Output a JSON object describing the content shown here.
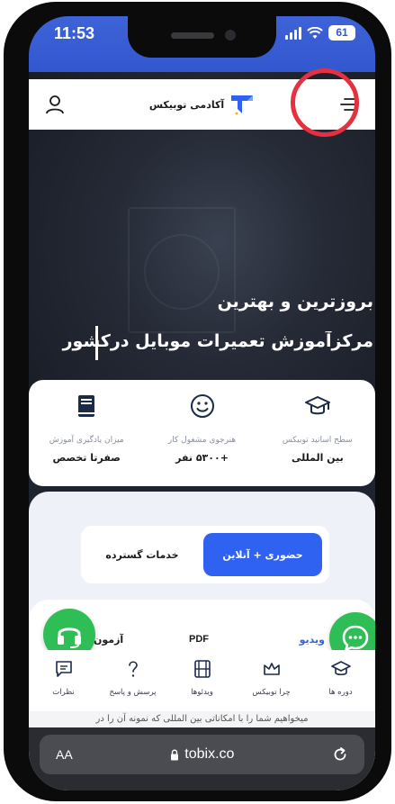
{
  "status_bar": {
    "time": "11:53",
    "battery": "61"
  },
  "header": {
    "brand": "آکادمی توبیکس"
  },
  "hero": {
    "line1": "بروزترین و بهترین",
    "line2": "مرکزآموزش تعمیرات موبایل درکشور"
  },
  "stats": [
    {
      "label": "سطح اساتید توبیکس",
      "value": "بین المللی",
      "icon": "graduation-cap-icon"
    },
    {
      "label": "هنرجوی مشغول کار",
      "value": "+۵۳۰۰ نفر",
      "icon": "smiley-icon"
    },
    {
      "label": "میزان یادگیری آموزش",
      "value": "صفرتا تخصص",
      "icon": "book-icon"
    }
  ],
  "tabs": {
    "active": "حضوری + آنلاین",
    "inactive": "خدمات گسترده"
  },
  "media": {
    "video": "ویدیو",
    "pdf": "PDF",
    "exam": "آزمون"
  },
  "bottom_nav": [
    {
      "label": "دوره ها",
      "icon": "graduation-cap-icon"
    },
    {
      "label": "چرا توبیکس",
      "icon": "crown-icon"
    },
    {
      "label": "ویدئوها",
      "icon": "film-icon"
    },
    {
      "label": "پرسش و پاسخ",
      "icon": "question-icon"
    },
    {
      "label": "نظرات",
      "icon": "comment-icon"
    }
  ],
  "peek_text": "میخواهیم شما را با امکاناتی بین المللی که نمونه آن را در",
  "browser": {
    "aa": "AA",
    "url": "tobix.co"
  },
  "colors": {
    "accent": "#2f62f0",
    "green": "#2fbd55",
    "highlight": "#e53040"
  }
}
